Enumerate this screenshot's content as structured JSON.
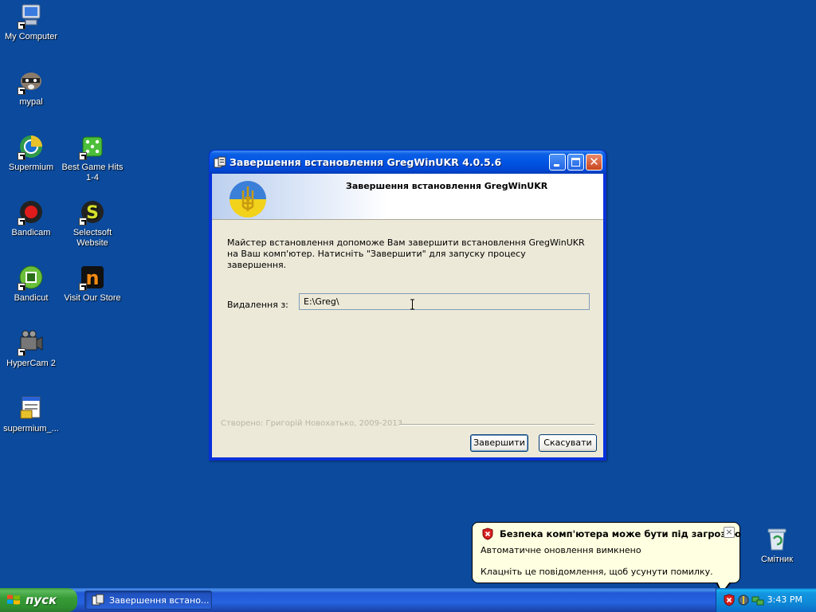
{
  "desktop": {
    "icons": [
      {
        "label": "My Computer",
        "icon": "my-computer-icon"
      },
      {
        "label": "mypal",
        "icon": "mypal-icon"
      },
      {
        "label": "Supermium",
        "icon": "supermium-icon"
      },
      {
        "label": "Best Game Hits 1-4",
        "icon": "best-game-hits-icon"
      },
      {
        "label": "Bandicam",
        "icon": "bandicam-icon"
      },
      {
        "label": "Selectsoft Website",
        "icon": "selectsoft-icon"
      },
      {
        "label": "Bandicut",
        "icon": "bandicut-icon"
      },
      {
        "label": "Visit Our Store",
        "icon": "visit-store-icon"
      },
      {
        "label": "HyperCam 2",
        "icon": "hypercam-icon"
      },
      {
        "label": "supermium_...",
        "icon": "installer-icon"
      },
      {
        "label": "Смітник",
        "icon": "recycle-bin-icon"
      }
    ]
  },
  "dialog": {
    "title": "Завершення встановлення GregWinUKR 4.0.5.6",
    "heading": "Завершення встановлення GregWinUKR",
    "description": "Майстер встановлення допоможе Вам завершити встановлення GregWinUKR на Ваш комп'ютер. Натисніть \"Завершити\" для запуску процесу завершення.",
    "field_label": "Видалення з:",
    "field_value": "E:\\Greg\\",
    "credit": "Створено: Григорій Новохатько, 2009-2013",
    "finish_label": "Завершити",
    "cancel_label": "Скасувати"
  },
  "balloon": {
    "title": "Безпека комп'ютера може бути під загрозою",
    "line1": "Автоматичне оновлення вимкнено",
    "line2": "Клацніть це повідомлення, щоб усунути помилку.",
    "close_label": "×"
  },
  "taskbar": {
    "start_label": "пуск",
    "task_label": "Завершення встано...",
    "clock": "3:43 PM"
  },
  "colors": {
    "desktop": "#0b4a9c",
    "titlebar": "#0054e3",
    "dialog_face": "#ece9d8",
    "balloon": "#ffffe1"
  }
}
